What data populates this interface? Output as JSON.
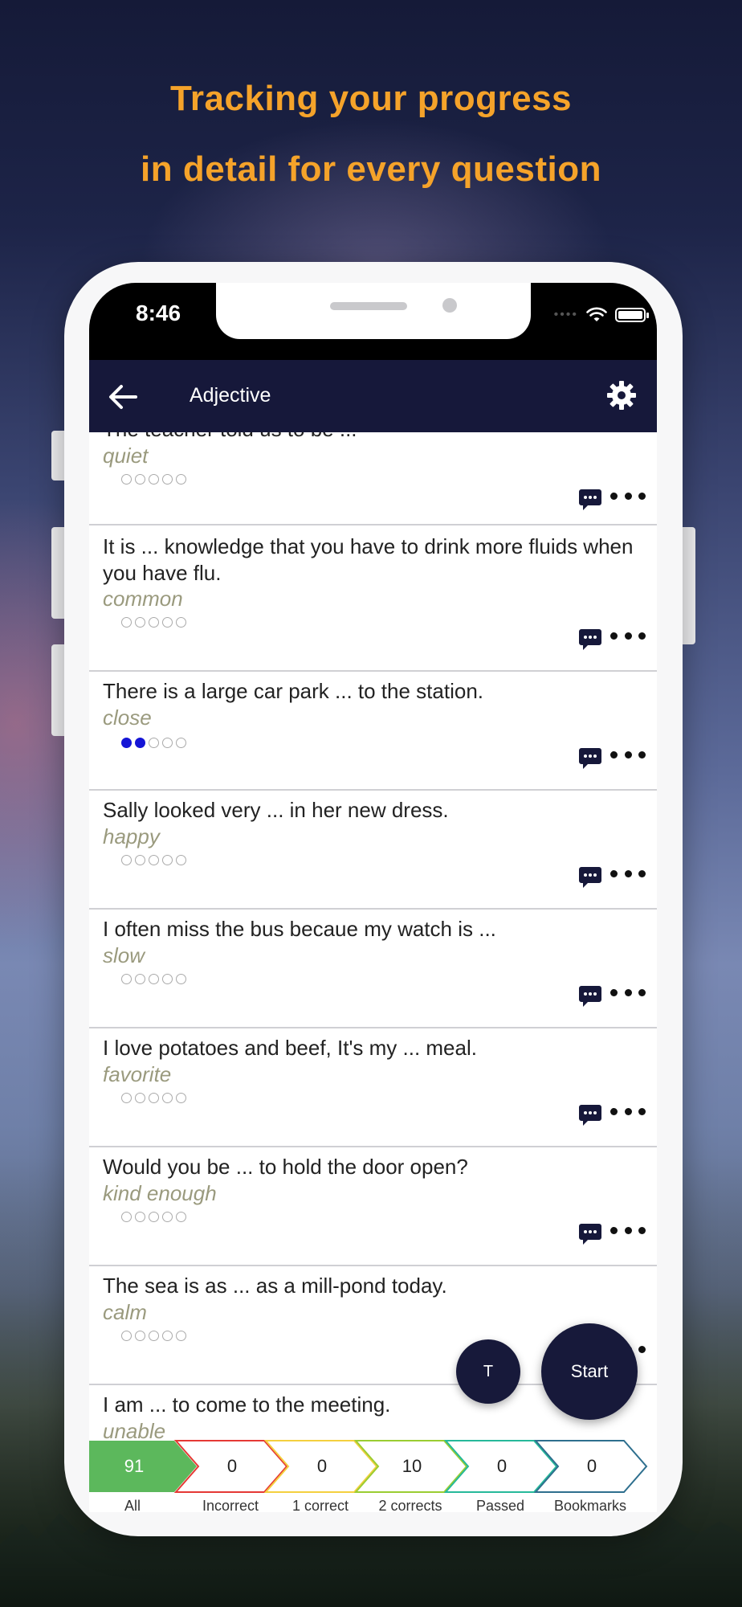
{
  "headline": {
    "line1": "Tracking your progress",
    "line2": "in detail for every question"
  },
  "status_bar": {
    "time": "8:46"
  },
  "app_bar": {
    "title": "Adjective"
  },
  "questions": [
    {
      "question": "The teacher told us to be ...",
      "answer": "quiet",
      "progress": 0
    },
    {
      "question": "It is ... knowledge that you have to drink more fluids when you have flu.",
      "answer": "common",
      "progress": 0
    },
    {
      "question": "There is a large car park ... to the station.",
      "answer": "close",
      "progress": 2
    },
    {
      "question": "Sally looked very ... in her new dress.",
      "answer": "happy",
      "progress": 0
    },
    {
      "question": "I often miss the bus becaue my watch is ...",
      "answer": "slow",
      "progress": 0
    },
    {
      "question": "I love potatoes and beef, It's my ... meal.",
      "answer": "favorite",
      "progress": 0
    },
    {
      "question": "Would you be ... to hold the door open?",
      "answer": "kind enough",
      "progress": 0
    },
    {
      "question": "The sea is as ... as a mill-pond today.",
      "answer": "calm",
      "progress": 0
    },
    {
      "question": "I am ... to come to the meeting.",
      "answer": "unable",
      "progress": 0
    }
  ],
  "fab": {
    "t_label": "T",
    "start_label": "Start"
  },
  "filters": [
    {
      "count": "91",
      "label": "All",
      "color": "#5cb85c"
    },
    {
      "count": "0",
      "label": "Incorrect",
      "color": "#e53935"
    },
    {
      "count": "0",
      "label": "1 correct",
      "color": "#f4d03f"
    },
    {
      "count": "10",
      "label": "2 corrects",
      "color": "#9acd32"
    },
    {
      "count": "0",
      "label": "Passed",
      "color": "#26b99a"
    },
    {
      "count": "0",
      "label": "Bookmarks",
      "color": "#2e6f8e"
    }
  ],
  "colors": {
    "headline": "#f5a32a",
    "app_bar": "#16183a",
    "answer": "#9a9a7e",
    "progress_filled": "#1515d6"
  }
}
